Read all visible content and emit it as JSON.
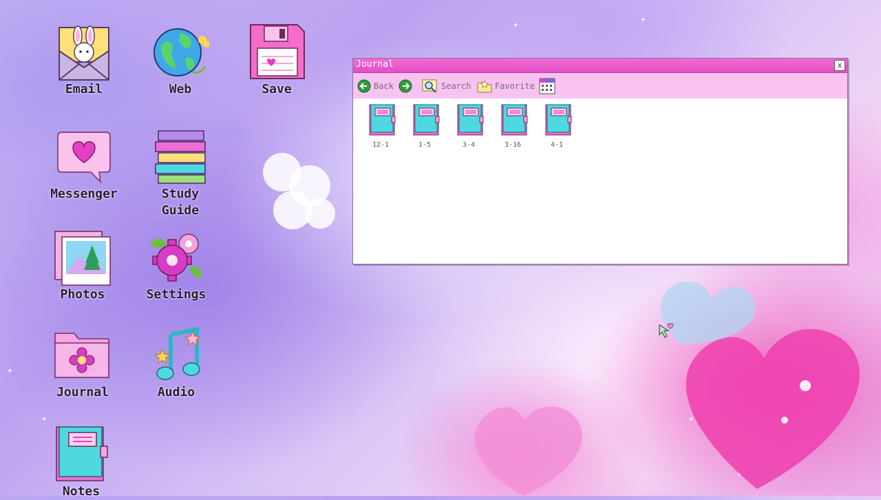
{
  "desktop": {
    "icons": {
      "email": "Email",
      "web": "Web",
      "save": "Save",
      "messenger": "Messenger",
      "study_guide_line1": "Study",
      "study_guide_line2": "Guide",
      "photos": "Photos",
      "settings": "Settings",
      "journal": "Journal",
      "audio": "Audio",
      "notes": "Notes"
    }
  },
  "window": {
    "title": "Journal",
    "close_label": "x",
    "toolbar": {
      "back": "Back",
      "search": "Search",
      "favorite": "Favorite"
    },
    "files": [
      "12-1",
      "1-5",
      "3-4",
      "3-16",
      "4-1"
    ]
  },
  "colors": {
    "titlebar": "#e24fc4",
    "toolbar": "#f8c2f1",
    "accent_pink": "#e63fc7",
    "accent_teal": "#4fd8e0"
  }
}
